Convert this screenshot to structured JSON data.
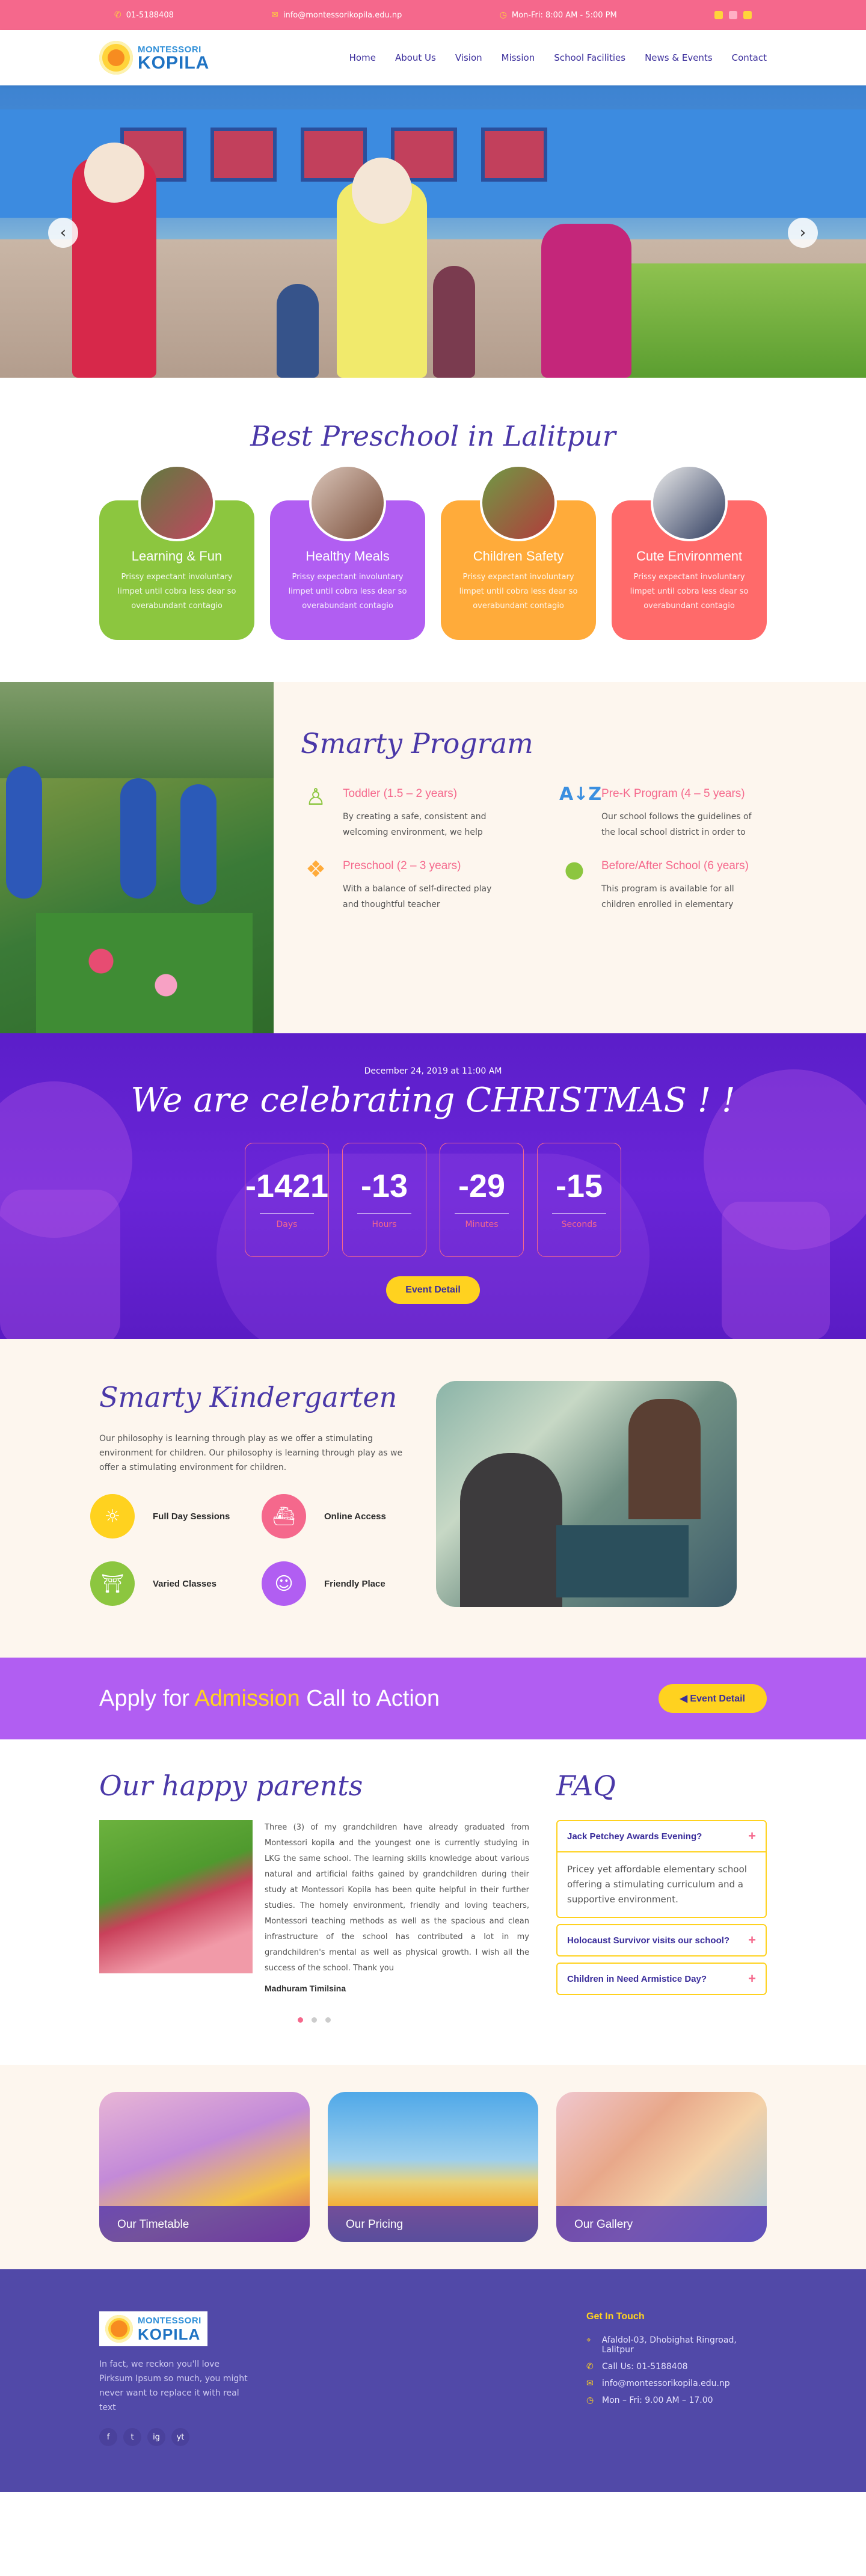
{
  "topbar": {
    "phone": "01-5188408",
    "email": "info@montessorikopila.edu.np",
    "hours": "Mon-Fri: 8:00 AM - 5:00 PM",
    "socials": [
      "facebook-icon",
      "instagram-icon",
      "twitter-icon"
    ]
  },
  "logo": {
    "line1": "MONTESSORI",
    "line2": "KOPILA"
  },
  "nav": [
    "Home",
    "About Us",
    "Vision",
    "Mission",
    "School Facilities",
    "News & Events",
    "Contact"
  ],
  "hero": {
    "prev": "‹",
    "next": "›"
  },
  "best": {
    "title": "Best Preschool in Lalitpur",
    "cards": [
      {
        "title": "Learning & Fun",
        "text": "Prissy expectant involuntary limpet until cobra less dear so overabundant contagio",
        "color": "#8cc63f"
      },
      {
        "title": "Healthy Meals",
        "text": "Prissy expectant involuntary limpet until cobra less dear so overabundant contagio",
        "color": "#b15ef2"
      },
      {
        "title": "Children Safety",
        "text": "Prissy expectant involuntary limpet until cobra less dear so overabundant contagio",
        "color": "#ffab3a"
      },
      {
        "title": "Cute Environment",
        "text": "Prissy expectant involuntary limpet until cobra less dear so overabundant contagio",
        "color": "#ff6a6a"
      }
    ]
  },
  "program": {
    "title": "Smarty Program",
    "items": [
      {
        "icon": "child-icon",
        "title": "Toddler (1.5 – 2 years)",
        "text": "By creating a safe, consistent and welcoming environment, we help"
      },
      {
        "icon": "sort-az-icon",
        "title": "Pre-K Program (4 – 5 years)",
        "text": "Our school follows the guidelines of the local school district in order to"
      },
      {
        "icon": "paw-icon",
        "title": "Preschool (2 – 3 years)",
        "text": "With a balance of self-directed play and thoughtful teacher"
      },
      {
        "icon": "apple-icon",
        "title": "Before/After School (6 years)",
        "text": "This program is available for all children enrolled in elementary"
      }
    ]
  },
  "christmas": {
    "date": "December 24, 2019 at 11:00 AM",
    "title": "We are celebrating CHRISTMAS ! !",
    "counts": [
      {
        "value": "-1421",
        "label": "Days"
      },
      {
        "value": "-13",
        "label": "Hours"
      },
      {
        "value": "-29",
        "label": "Minutes"
      },
      {
        "value": "-15",
        "label": "Seconds"
      }
    ],
    "button": "Event Detail"
  },
  "kinder": {
    "title": "Smarty Kindergarten",
    "intro": "Our philosophy is learning through play as we offer a stimulating environment for children. Our philosophy is learning through play as we offer a stimulating environment for children.",
    "features": [
      {
        "label": "Full Day Sessions",
        "icon": "sun-icon",
        "color": "#ffd21f"
      },
      {
        "label": "Online Access",
        "icon": "submarine-icon",
        "color": "#f5688c"
      },
      {
        "label": "Varied Classes",
        "icon": "playground-icon",
        "color": "#8cc63f"
      },
      {
        "label": "Friendly Place",
        "icon": "smiley-icon",
        "color": "#b15ef2"
      }
    ]
  },
  "apply": {
    "pre": "Apply for ",
    "highlight": "Admission",
    "post": " Call to Action",
    "button": "Event Detail"
  },
  "parents": {
    "title": "Our happy parents",
    "text": "Three (3) of my grandchildren have already graduated from Montessori kopila and the youngest one is currently studying in LKG the same school. The learning skills knowledge about various natural and artificial faiths gained by grandchildren during their study at Montessori Kopila has been quite helpful in their further studies. The homely environment, friendly and loving teachers, Montessori teaching methods as well as the spacious and clean infrastructure of the school has contributed a lot in my grandchildren's mental as well as physical growth. I wish all the success of the school. Thank you",
    "author": "Madhuram Timilsina"
  },
  "faq": {
    "title": "FAQ",
    "items": [
      {
        "q": "Jack Petchey Awards Evening?",
        "a": "Pricey yet affordable elementary school offering a stimulating curriculum and a supportive environment.",
        "open": true
      },
      {
        "q": "Holocaust Survivor visits our school?",
        "a": "",
        "open": false
      },
      {
        "q": "Children in Need Armistice Day?",
        "a": "",
        "open": false
      }
    ]
  },
  "gallery": [
    "Our Timetable",
    "Our Pricing",
    "Our Gallery"
  ],
  "footer": {
    "description": "In fact, we reckon you'll love Pirksum Ipsum so much, you might never want to replace it with real text",
    "socials": [
      "f",
      "t",
      "ig",
      "yt"
    ],
    "contact_title": "Get In Touch",
    "address": "Afaldol-03, Dhobighat Ringroad, Lalitpur",
    "phone": "Call Us: 01-5188408",
    "email": "info@montessorikopila.edu.np",
    "hours": "Mon – Fri: 9.00 AM – 17.00"
  }
}
